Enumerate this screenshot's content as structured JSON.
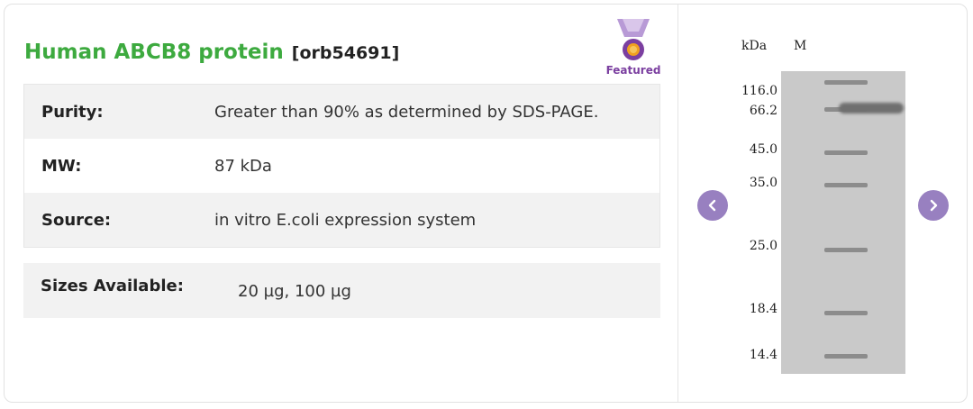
{
  "product": {
    "name": "Human ABCB8 protein",
    "code": "[orb54691]",
    "badge": "Featured"
  },
  "specs": [
    {
      "label": "Purity:",
      "value": "Greater than 90% as determined by SDS-PAGE."
    },
    {
      "label": "MW:",
      "value": "87 kDa"
    },
    {
      "label": "Source:",
      "value": "in vitro E.coli expression system"
    }
  ],
  "sizes": {
    "label": "Sizes Available:",
    "value": "20 µg, 100 µg"
  },
  "gel": {
    "col_kda": "kDa",
    "col_marker": "M",
    "markers": [
      "116.0",
      "66.2",
      "45.0",
      "35.0",
      "25.0",
      "18.4",
      "14.4"
    ]
  },
  "icons": {
    "prev": "chevron-left-icon",
    "next": "chevron-right-icon",
    "badge": "medal-icon"
  },
  "colors": {
    "title": "#3daa3f",
    "badge": "#7b3fa0",
    "nav": "#9880c0"
  }
}
